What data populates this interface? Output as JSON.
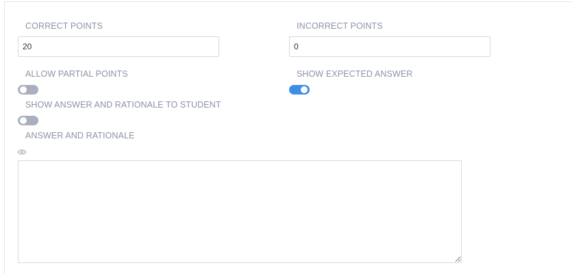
{
  "fields": {
    "correct_points": {
      "label": "CORRECT POINTS",
      "value": "20"
    },
    "incorrect_points": {
      "label": "INCORRECT POINTS",
      "value": "0"
    }
  },
  "toggles": {
    "allow_partial_points": {
      "label": "ALLOW PARTIAL POINTS",
      "on": false
    },
    "show_expected_answer": {
      "label": "SHOW EXPECTED ANSWER",
      "on": true
    },
    "show_answer_rationale": {
      "label": "SHOW ANSWER AND RATIONALE TO STUDENT",
      "on": false
    }
  },
  "answer_rationale": {
    "label": "ANSWER AND RATIONALE",
    "preview_icon": "eye-icon",
    "value": ""
  },
  "colors": {
    "label": "#8a93a6",
    "toggle_on": "#3d8ee8",
    "toggle_off": "#a9afbe",
    "border": "#d6d9de"
  }
}
